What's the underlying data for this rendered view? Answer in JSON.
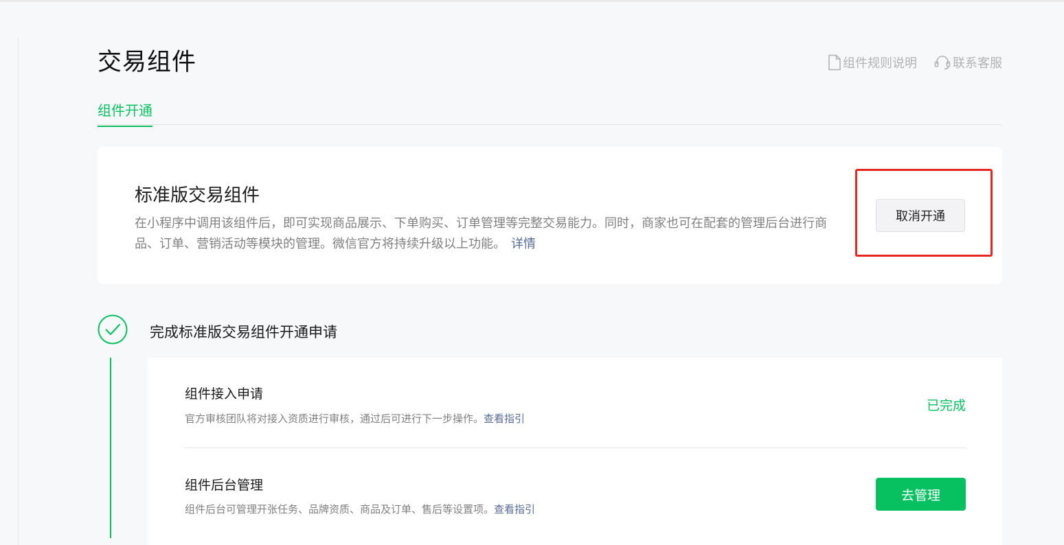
{
  "header": {
    "title": "交易组件",
    "links": [
      {
        "label": "组件规则说明",
        "icon": "document-icon"
      },
      {
        "label": "联系客服",
        "icon": "headset-icon"
      }
    ]
  },
  "tabs": [
    {
      "label": "组件开通",
      "active": true
    }
  ],
  "component_card": {
    "title": "标准版交易组件",
    "description": "在小程序中调用该组件后，即可实现商品展示、下单购买、订单管理等完整交易能力。同时，商家也可在配套的管理后台进行商品、订单、营销活动等模块的管理。微信官方将持续升级以上功能。",
    "detail_link": "详情",
    "cancel_button": "取消开通"
  },
  "step": {
    "title": "完成标准版交易组件开通申请",
    "icon": "check-circle-icon",
    "items": [
      {
        "title": "组件接入申请",
        "desc": "官方审核团队将对接入资质进行审核，通过后可进行下一步操作。",
        "link": "查看指引",
        "status": "已完成"
      },
      {
        "title": "组件后台管理",
        "desc": "组件后台可管理开张任务、品牌资质、商品及订单、售后等设置项。",
        "link": "查看指引",
        "button": "去管理"
      }
    ]
  },
  "colors": {
    "brand_green": "#07c160",
    "link_blue": "#576b95",
    "highlight_red": "#e7261f",
    "page_bg": "#f7f8fa"
  }
}
